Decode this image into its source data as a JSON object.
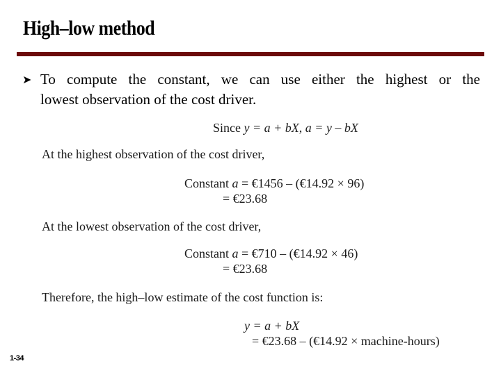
{
  "slide": {
    "title": "High–low method",
    "accent_color": "#6b0a0a",
    "bullet": {
      "icon": "arrow-bullet-icon",
      "line1": "To compute the constant, we can use either the highest or the",
      "line2": "lowest observation of the cost driver."
    },
    "since_line": {
      "prefix": "Since ",
      "equation1": "y = a + bX",
      "sep": ", ",
      "equation2": "a = y – bX"
    },
    "highest": {
      "heading": "At the highest observation of the cost driver,",
      "label": "Constant ",
      "var": "a",
      "expr": " = €1456 – (€14.92 × 96)",
      "result": "= €23.68"
    },
    "lowest": {
      "heading": "At the lowest observation of the cost driver,",
      "label": "Constant ",
      "var": "a",
      "expr": " = €710 – (€14.92 × 46)",
      "result": "= €23.68"
    },
    "conclusion": {
      "heading": "Therefore, the high–low estimate of the cost function is:",
      "equation": "y = a + bX",
      "result": "= €23.68 – (€14.92 × machine-hours)"
    },
    "slide_number": "1-34"
  }
}
